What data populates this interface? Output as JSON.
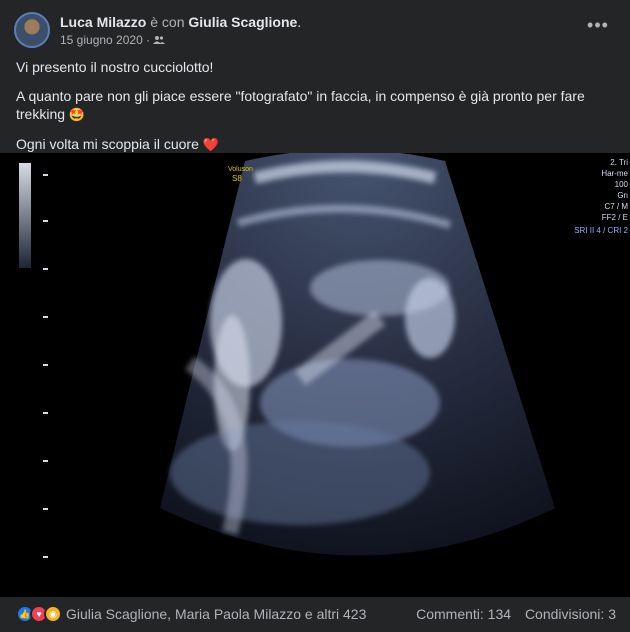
{
  "post": {
    "author": "Luca Milazzo",
    "with_word": "è con",
    "tagged": "Giulia Scaglione",
    "tagged_suffix": ".",
    "date": "15 giugno 2020",
    "audience_icon": "friends-icon",
    "more_icon": "more-icon",
    "text_lines": [
      "Vi presento il nostro cucciolotto!",
      "A quanto pare non gli piace essere \"fotografato\" in faccia, in compenso è già pronto per fare trekking",
      "Ogni volta mi scoppia il cuore"
    ],
    "emoji_1": "🤩",
    "emoji_2": "❤️"
  },
  "ultrasound": {
    "top_label_1": "Voluson",
    "top_label_2": "S8",
    "right_labels": [
      "2. Tri",
      "Har-me",
      "100",
      "Gn",
      "C7 / M",
      "FF2 / E",
      "SRI II 4 / CRI 2"
    ]
  },
  "footer": {
    "reaction_icons": [
      "like-icon",
      "love-icon",
      "wow-icon"
    ],
    "reactions_text": "Giulia Scaglione, Maria Paola Milazzo e altri 423",
    "comments": "Commenti: 134",
    "shares": "Condivisioni: 3"
  },
  "colors": {
    "background": "#242526",
    "text_primary": "#e4e6eb",
    "text_secondary": "#b0b3b8",
    "like": "#1877f2",
    "love": "#f33e58",
    "wow": "#f7b125",
    "ultrasound_label": "#d7c600",
    "ultrasound_right": "#8fb1ff"
  }
}
